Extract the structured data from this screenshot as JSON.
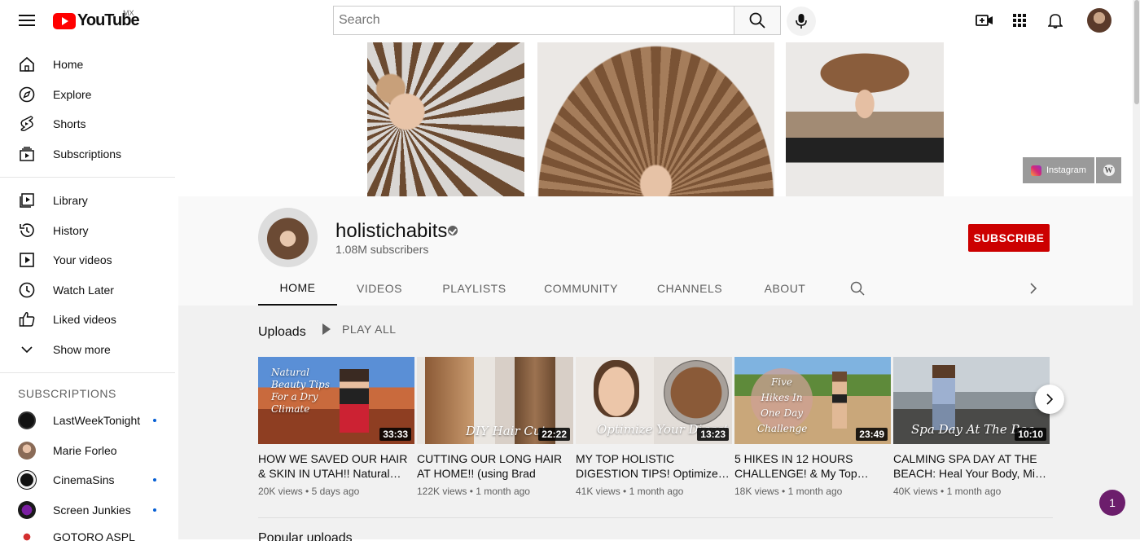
{
  "header": {
    "logo_text": "YouTube",
    "country_code": "MX",
    "search_placeholder": "Search",
    "icons": [
      "menu-icon",
      "search-icon",
      "mic-icon",
      "create-video-icon",
      "apps-grid-icon",
      "notifications-bell-icon",
      "account-avatar"
    ]
  },
  "sidebar": {
    "primary": [
      {
        "label": "Home",
        "icon": "home-icon"
      },
      {
        "label": "Explore",
        "icon": "compass-icon"
      },
      {
        "label": "Shorts",
        "icon": "shorts-icon"
      },
      {
        "label": "Subscriptions",
        "icon": "subscriptions-icon"
      }
    ],
    "secondary": [
      {
        "label": "Library",
        "icon": "library-icon"
      },
      {
        "label": "History",
        "icon": "history-icon"
      },
      {
        "label": "Your videos",
        "icon": "your-videos-icon"
      },
      {
        "label": "Watch Later",
        "icon": "clock-icon"
      },
      {
        "label": "Liked videos",
        "icon": "thumbs-up-icon"
      },
      {
        "label": "Show more",
        "icon": "chevron-down-icon"
      }
    ],
    "subscriptions_heading": "SUBSCRIPTIONS",
    "subscriptions": [
      {
        "name": "LastWeekTonight",
        "new": true
      },
      {
        "name": "Marie Forleo",
        "new": false
      },
      {
        "name": "CinemaSins",
        "new": true
      },
      {
        "name": "Screen Junkies",
        "new": true
      },
      {
        "name": "GOTORO ASPL",
        "new": false
      }
    ]
  },
  "banner": {
    "links": [
      {
        "label": "Instagram",
        "icon": "instagram-icon"
      },
      {
        "label": "",
        "icon": "wordpress-icon"
      }
    ]
  },
  "channel": {
    "name": "holistichabits",
    "subscribers": "1.08M subscribers",
    "subscribe_label": "SUBSCRIBE",
    "tabs": [
      "HOME",
      "VIDEOS",
      "PLAYLISTS",
      "COMMUNITY",
      "CHANNELS",
      "ABOUT"
    ],
    "active_tab": "HOME"
  },
  "uploads": {
    "title": "Uploads",
    "play_all": "PLAY ALL",
    "videos": [
      {
        "title": "HOW WE SAVED OUR HAIR & SKIN IN UTAH!! Natural…",
        "views": "20K views",
        "age": "5 days ago",
        "duration": "33:33",
        "thumb_text": "Natural Beauty Tips For a Dry Climate"
      },
      {
        "title": "CUTTING OUR LONG HAIR AT HOME!! (using Brad Mondo'…",
        "views": "122K views",
        "age": "1 month ago",
        "duration": "22:22",
        "thumb_text": "DIY Hair Cut"
      },
      {
        "title": "MY TOP HOLISTIC DIGESTION TIPS! Optimize…",
        "views": "41K views",
        "age": "1 month ago",
        "duration": "13:23",
        "thumb_text": "Optimize Your Digest"
      },
      {
        "title": "5 HIKES IN 12 HOURS CHALLENGE! & My Top…",
        "views": "18K views",
        "age": "1 month ago",
        "duration": "23:49",
        "thumb_text": "Five Hikes In One Day Challenge"
      },
      {
        "title": "CALMING SPA DAY AT THE BEACH: Heal Your Body, Mi…",
        "views": "40K views",
        "age": "1 month ago",
        "duration": "10:10",
        "thumb_text": "Spa Day At The Bea"
      }
    ]
  },
  "next_section": "Popular uploads",
  "notification_chip": "1"
}
